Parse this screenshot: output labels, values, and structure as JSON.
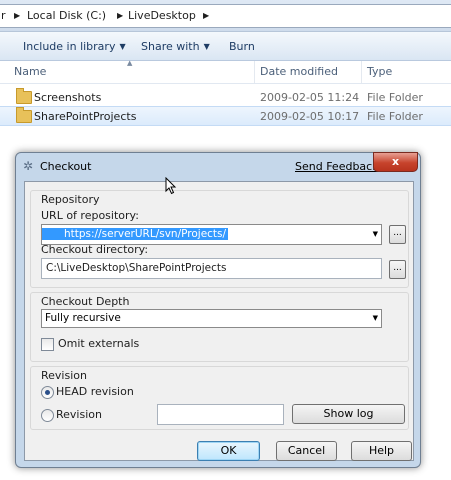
{
  "explorer": {
    "breadcrumb": {
      "lead": "r",
      "sep": "▶",
      "items": [
        "Local Disk (C:)",
        "LiveDesktop"
      ]
    },
    "toolbar": {
      "include_label": "Include in library",
      "share_label": "Share with",
      "burn_label": "Burn"
    },
    "columns": {
      "name": "Name",
      "date": "Date modified",
      "type": "Type"
    },
    "files": [
      {
        "name": "Screenshots",
        "date": "2009-02-05 11:24",
        "type": "File Folder"
      },
      {
        "name": "SharePointProjects",
        "date": "2009-02-05 10:17",
        "type": "File Folder"
      }
    ]
  },
  "dialog": {
    "title": "Checkout",
    "feedback_link": "Send Feedback",
    "close_glyph": "x",
    "repository": {
      "group_label": "Repository",
      "url_label": "URL of repository:",
      "url_value": "https://serverURL/svn/Projects/",
      "dir_label": "Checkout directory:",
      "dir_value": "C:\\LiveDesktop\\SharePointProjects",
      "browse_label": "..."
    },
    "depth": {
      "group_label": "Checkout Depth",
      "selected": "Fully recursive",
      "omit_externals_label": "Omit externals",
      "omit_externals_checked": false
    },
    "revision": {
      "group_label": "Revision",
      "head_label": "HEAD revision",
      "revision_label": "Revision",
      "selected": "HEAD revision",
      "revision_value": "",
      "show_log_label": "Show log"
    },
    "buttons": {
      "ok": "OK",
      "cancel": "Cancel",
      "help": "Help"
    }
  }
}
